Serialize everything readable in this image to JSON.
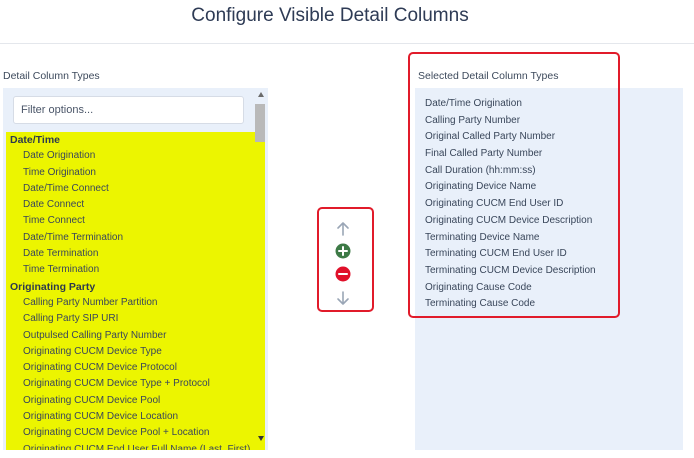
{
  "title": "Configure Visible Detail Columns",
  "left": {
    "label": "Detail Column Types",
    "filter_placeholder": "Filter options...",
    "groups": [
      {
        "header": "Date/Time",
        "items": [
          "Date Origination",
          "Time Origination",
          "Date/Time Connect",
          "Date Connect",
          "Time Connect",
          "Date/Time Termination",
          "Date Termination",
          "Time Termination"
        ]
      },
      {
        "header": "Originating Party",
        "items": [
          "Calling Party Number Partition",
          "Calling Party SIP URI",
          "Outpulsed Calling Party Number",
          "Originating CUCM Device Type",
          "Originating CUCM Device Protocol",
          "Originating CUCM Device Type + Protocol",
          "Originating CUCM Device Pool",
          "Originating CUCM Device Location",
          "Originating CUCM Device Pool + Location",
          "Originating CUCM End User Full Name (Last, First)"
        ]
      }
    ]
  },
  "controls": {
    "up_icon": "arrow-up-icon",
    "add_icon": "plus-circle-icon",
    "remove_icon": "minus-circle-icon",
    "down_icon": "arrow-down-icon",
    "add_color": "#3d7a46",
    "remove_color": "#e0102a"
  },
  "right": {
    "label": "Selected Detail Column Types",
    "items": [
      "Date/Time Origination",
      "Calling Party Number",
      "Original Called Party Number",
      "Final Called Party Number",
      "Call Duration (hh:mm:ss)",
      "Originating Device Name",
      "Originating CUCM End User ID",
      "Originating CUCM Device Description",
      "Terminating Device Name",
      "Terminating CUCM End User ID",
      "Terminating CUCM Device Description",
      "Originating Cause Code",
      "Terminating Cause Code"
    ]
  },
  "colors": {
    "highlight": "#ecf500",
    "panel_bg": "#e9f0fa",
    "annotation_red": "#e11b2a"
  }
}
